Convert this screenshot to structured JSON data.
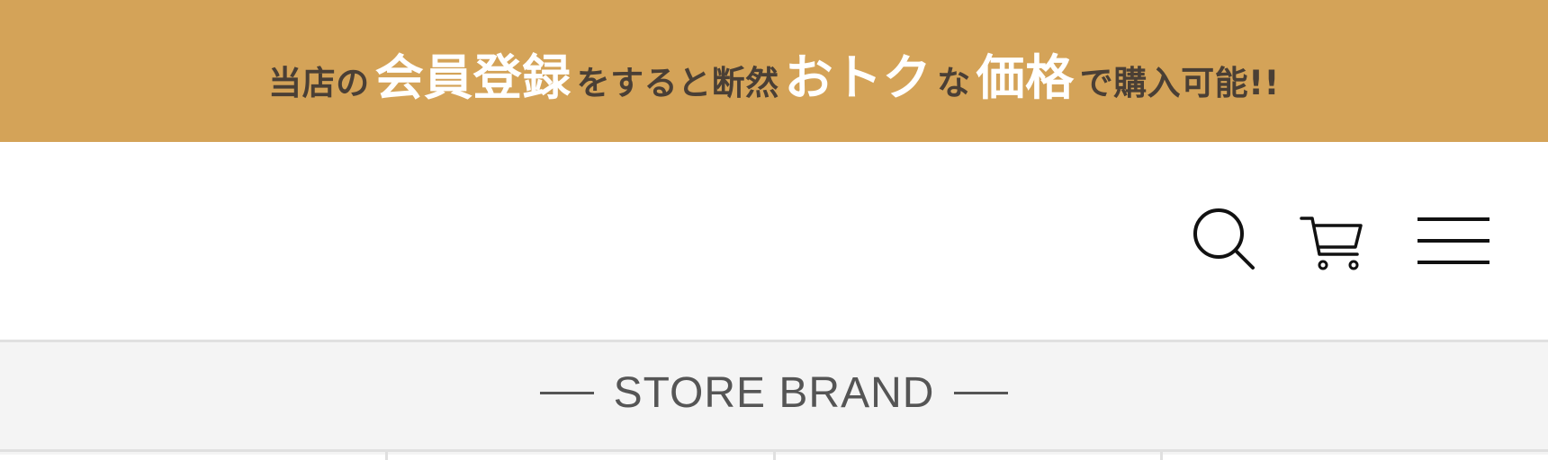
{
  "promo_banner": {
    "segments": [
      {
        "text": "当店の",
        "style": "small"
      },
      {
        "text": "会員登録",
        "style": "big"
      },
      {
        "text": "をすると断然",
        "style": "small"
      },
      {
        "text": "おトク",
        "style": "big"
      },
      {
        "text": "な",
        "style": "small"
      },
      {
        "text": "価格",
        "style": "big"
      },
      {
        "text": "で購入可能!!",
        "style": "small"
      }
    ],
    "background_color": "#d4a358",
    "highlight_color": "#ffffff",
    "text_color": "#4a3f35"
  },
  "header": {
    "icons": {
      "search": "search-icon",
      "cart": "cart-icon",
      "menu": "hamburger-menu-icon"
    }
  },
  "brand_section": {
    "title": "STORE BRAND",
    "background_color": "#f4f4f4"
  }
}
